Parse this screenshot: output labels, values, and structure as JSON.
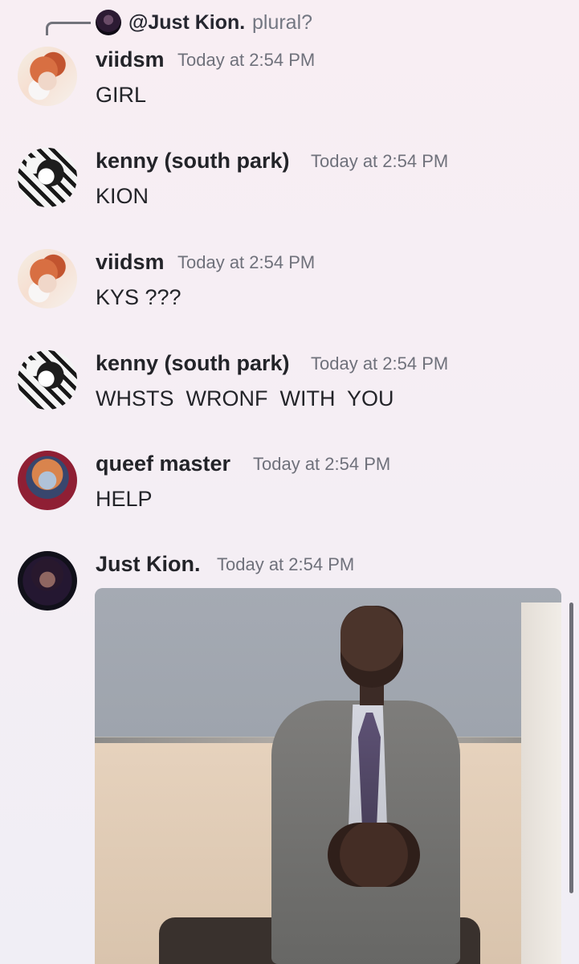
{
  "reply": {
    "author": "@Just Kion.",
    "text": "plural?"
  },
  "messages": [
    {
      "author": "viidsm",
      "timestamp": "Today at 2:54 PM",
      "content": "GIRL"
    },
    {
      "author": "kenny (south park)",
      "timestamp": "Today at 2:54 PM",
      "content": "KION"
    },
    {
      "author": "viidsm",
      "timestamp": "Today at 2:54 PM",
      "content": "KYS ???"
    },
    {
      "author": "kenny (south park)",
      "timestamp": "Today at 2:54 PM",
      "content": "WHSTS  WRONF  WITH  YOU"
    },
    {
      "author": "queef master",
      "timestamp": "Today at 2:54 PM",
      "content": "HELP"
    },
    {
      "author": "Just Kion.",
      "timestamp": "Today at 2:54 PM",
      "content": ""
    }
  ],
  "colors": {
    "text_primary": "#232429",
    "text_secondary": "#6f717b",
    "background_top": "#f8eef3",
    "background_bottom": "#f0eef5"
  },
  "icons": {
    "reply_connector": "reply-connector-icon",
    "attachment_image": "image-attachment"
  }
}
